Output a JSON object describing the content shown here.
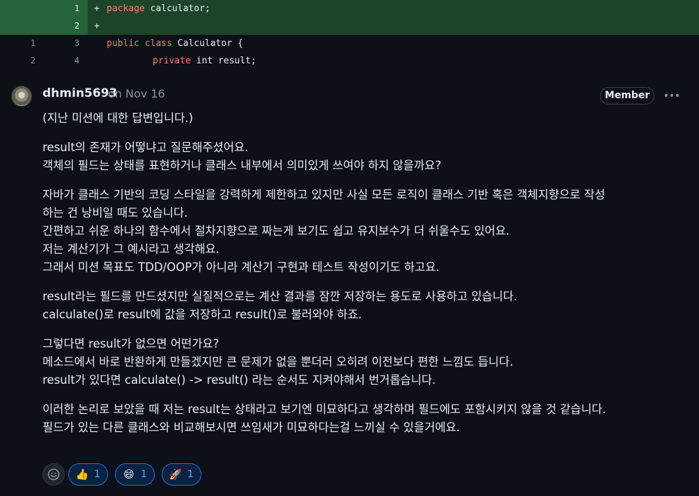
{
  "diff": {
    "lines": [
      {
        "old": "",
        "new": "1",
        "marker": "+",
        "type": "added",
        "kw": "package",
        "rest": " calculator;"
      },
      {
        "old": "",
        "new": "2",
        "marker": "+",
        "type": "added",
        "kw": "",
        "rest": ""
      },
      {
        "old": "1",
        "new": "3",
        "marker": "",
        "type": "ctx",
        "kw": "public class",
        "rest": " Calculator {"
      },
      {
        "old": "2",
        "new": "4",
        "marker": "",
        "type": "ctx",
        "kw": "private",
        "rest": " int result;",
        "indent": true
      }
    ]
  },
  "comment": {
    "author": "dhmin5693",
    "timestamp": "on Nov 16",
    "badge": "Member",
    "paragraphs": [
      [
        "(지난 미션에 대한 답변입니다.)"
      ],
      [
        "result의 존재가 어떻냐고 질문해주셨어요.",
        "객체의 필드는 상태를 표현하거나 클래스 내부에서 의미있게 쓰여야 하지 않을까요?"
      ],
      [
        "자바가 클래스 기반의 코딩 스타일을 강력하게 제한하고 있지만 사실 모든 로직이 클래스 기반 혹은 객체지향으로 작성",
        "하는 건 낭비일 때도 있습니다.",
        "간편하고 쉬운 하나의 함수에서 절차지향으로 짜는게 보기도 쉽고 유지보수가 더 쉬울수도 있어요.",
        "저는 계산기가 그 예시라고 생각해요.",
        "그래서 미션 목표도 TDD/OOP가 아니라 계산기 구현과 테스트 작성이기도 하고요."
      ],
      [
        "result라는 필드를 만드셨지만 실질적으로는 계산 결과를 잠깐 저장하는 용도로 사용하고 있습니다.",
        "calculate()로 result에 값을 저장하고 result()로 불러와야 하죠."
      ],
      [
        "그렇다면 result가 없으면 어떤가요?",
        "메소드에서 바로 반환하게 만들겠지만 큰 문제가 없을 뿐더러 오히려 이전보다 편한 느낌도 듭니다.",
        "result가 있다면 calculate() -> result() 라는 순서도 지켜야해서 번거롭습니다."
      ],
      [
        "이러한 논리로 보았을 때 저는 result는 상태라고 보기엔 미묘하다고 생각하며 필드에도 포함시키지 않을 것 같습니다.",
        "필드가 있는 다른 클래스와 비교해보시면 쓰임새가 미묘하다는걸 느끼실 수 있을거에요."
      ]
    ]
  },
  "reactions": [
    {
      "icon": "thumbs-up-icon",
      "emoji": "👍",
      "count": "1"
    },
    {
      "icon": "smile-icon",
      "emoji": "😄",
      "count": "1"
    },
    {
      "icon": "rocket-icon",
      "emoji": "🚀",
      "count": "1"
    }
  ],
  "colors": {
    "background": "#0d1117",
    "added_line": "#1c4428",
    "keyword": "#ff7b72",
    "reaction_border": "#1f6feb",
    "reaction_count": "#58a6ff"
  }
}
